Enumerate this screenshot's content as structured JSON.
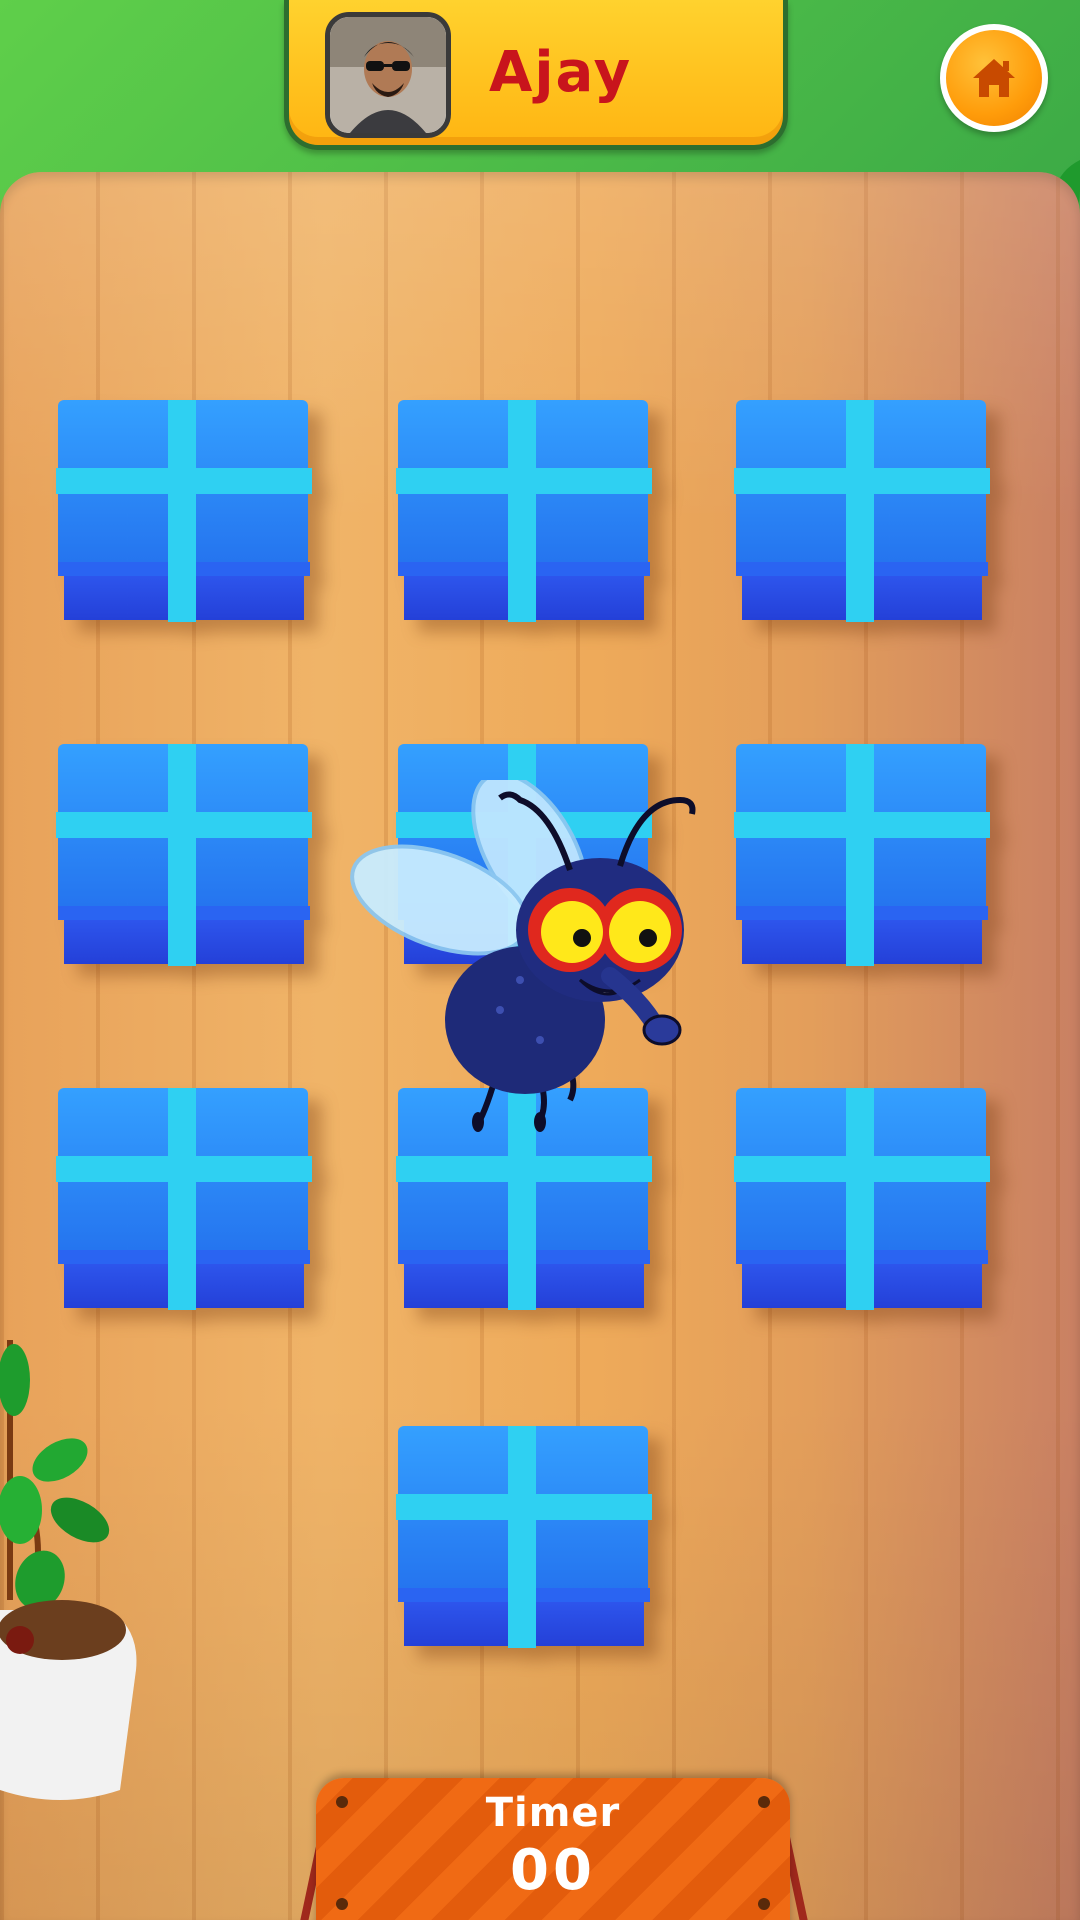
{
  "player": {
    "name": "Ajay",
    "avatar_icon": "player-avatar"
  },
  "header": {
    "home_icon": "home-icon"
  },
  "board": {
    "box_icon": "gift-box",
    "box_count": 10,
    "mascot_icon": "fly-character"
  },
  "timer": {
    "label": "Timer",
    "value": "00"
  },
  "colors": {
    "name_text": "#c8141c",
    "nameplate": "#ffc21e",
    "home_button": "#ff9c0a",
    "box_blue": "#2a7cf5",
    "ribbon": "#27d2f2",
    "timer_panel": "#f06a14"
  }
}
